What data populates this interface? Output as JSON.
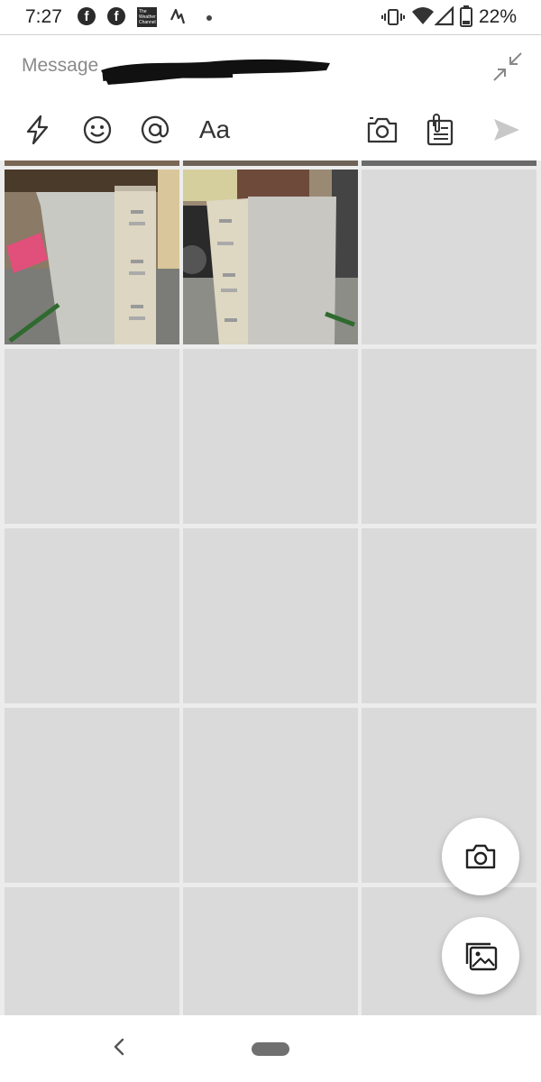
{
  "status_bar": {
    "time": "7:27",
    "battery_percent": "22%",
    "notification_icons": [
      "facebook-icon",
      "facebook-icon",
      "weather-channel-icon",
      "activity-icon",
      "dot"
    ],
    "weather_channel_badge": "The Weather Channel"
  },
  "composer": {
    "placeholder": "Message",
    "redacted": true,
    "toolbar_text_format_label": "Aa"
  },
  "photo_grid": {
    "columns": 3,
    "loaded_thumbnails": 2,
    "thumbnails": [
      "file-cabinet-photo-1",
      "file-cabinet-photo-2"
    ]
  },
  "fab": {
    "camera_icon": "camera-icon",
    "gallery_icon": "gallery-icon"
  },
  "colors": {
    "placeholder_gray": "#dadada",
    "send_disabled": "#c8c8c8"
  }
}
